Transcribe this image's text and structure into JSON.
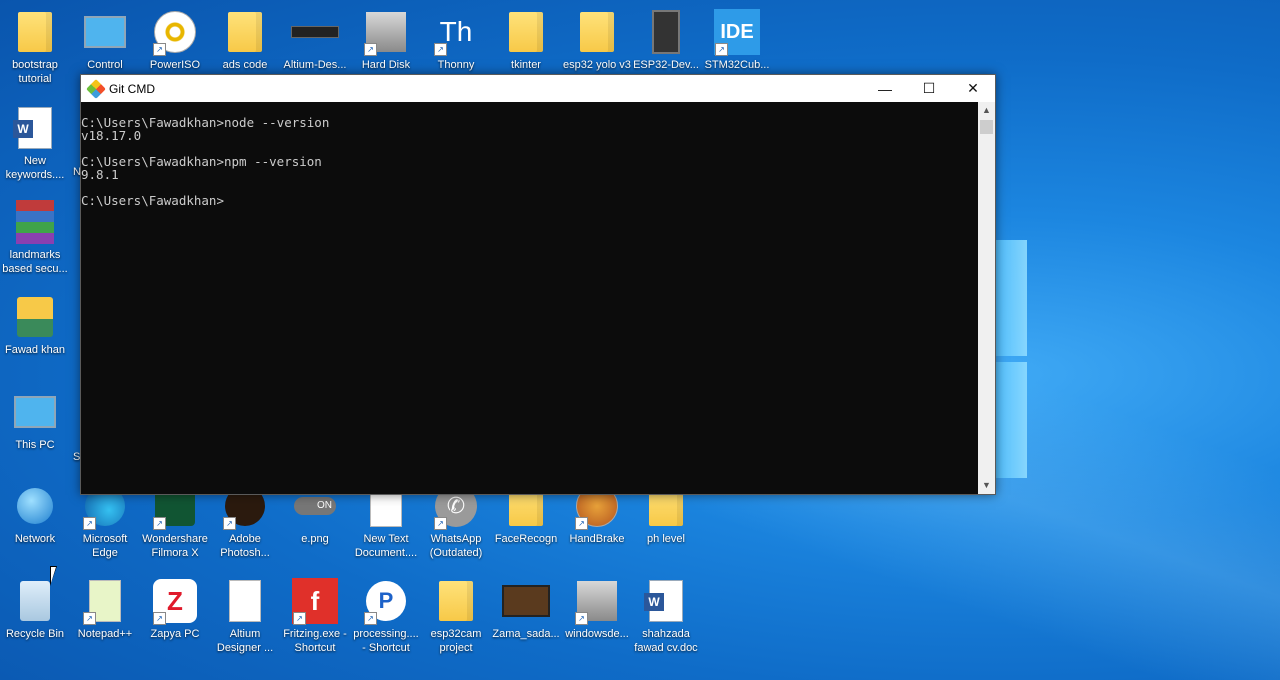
{
  "desktop": {
    "top_row": [
      {
        "label": "bootstrap\ntutorial",
        "icon": "folder-icon"
      },
      {
        "label": "Control",
        "icon": "control-panel-icon"
      },
      {
        "label": "PowerISO",
        "icon": "poweriso-icon"
      },
      {
        "label": "ads code",
        "icon": "folder-icon"
      },
      {
        "label": "Altium-Des...",
        "icon": "altium-icon"
      },
      {
        "label": "Hard Disk",
        "icon": "hard-disk-icon"
      },
      {
        "label": "Thonny",
        "icon": "thonny-icon"
      },
      {
        "label": "tkinter",
        "icon": "folder-icon"
      },
      {
        "label": "esp32 yolo v3",
        "icon": "folder-icon"
      },
      {
        "label": "ESP32-Dev...",
        "icon": "esp32-icon"
      },
      {
        "label": "STM32Cub...",
        "icon": "stm32-ide-icon",
        "tile_text": "IDE"
      }
    ],
    "left_column": [
      {
        "label": "New\nkeywords....",
        "icon": "word-doc-icon"
      },
      {
        "label": "landmarks\nbased secu...",
        "icon": "winrar-icon"
      },
      {
        "label": "Fawad khan",
        "icon": "user-folder-icon"
      },
      {
        "label": "This PC",
        "icon": "this-pc-icon"
      },
      {
        "label": "Network",
        "icon": "network-icon"
      },
      {
        "label": "Recycle Bin",
        "icon": "recycle-bin-icon"
      }
    ],
    "middle_row": [
      {
        "label": "Microsoft\nEdge",
        "icon": "edge-icon"
      },
      {
        "label": "Wondershare\nFilmora X",
        "icon": "filmora-icon"
      },
      {
        "label": "Adobe\nPhotosh...",
        "icon": "photoshop-icon"
      },
      {
        "label": "e.png",
        "icon": "toggle-image-icon",
        "toggle_text": "ON"
      },
      {
        "label": "New Text\nDocument....",
        "icon": "text-doc-icon"
      },
      {
        "label": "WhatsApp\n(Outdated)",
        "icon": "whatsapp-icon"
      },
      {
        "label": "FaceRecogn",
        "icon": "folder-icon"
      },
      {
        "label": "HandBrake",
        "icon": "handbrake-icon"
      },
      {
        "label": "ph level",
        "icon": "folder-icon"
      }
    ],
    "bottom_row": [
      {
        "label": "Notepad++",
        "icon": "notepadpp-icon"
      },
      {
        "label": "Zapya PC",
        "icon": "zapya-icon"
      },
      {
        "label": "Altium\nDesigner ...",
        "icon": "text-doc-icon"
      },
      {
        "label": "Fritzing.exe -\nShortcut",
        "icon": "fritzing-icon",
        "tile_text": "f"
      },
      {
        "label": "processing....\n- Shortcut",
        "icon": "processing-icon"
      },
      {
        "label": "esp32cam\nproject",
        "icon": "folder-icon"
      },
      {
        "label": "Zama_sada...",
        "icon": "video-icon"
      },
      {
        "label": "windowsde...",
        "icon": "windows-dev-icon"
      },
      {
        "label": "shahzada\nfawad cv.doc",
        "icon": "word-doc-icon"
      }
    ],
    "partial_labels": [
      "N",
      "S"
    ]
  },
  "window": {
    "title": "Git CMD",
    "minimize": "—",
    "maximize": "☐",
    "close": "✕",
    "lines": [
      "C:\\Users\\Fawadkhan>node --version",
      "v18.17.0",
      "",
      "C:\\Users\\Fawadkhan>npm --version",
      "9.8.1",
      "",
      "C:\\Users\\Fawadkhan>"
    ]
  },
  "colors": {
    "console_bg": "#0c0c0c",
    "console_text": "#cccccc",
    "desktop_accent": "#1c86e0"
  }
}
